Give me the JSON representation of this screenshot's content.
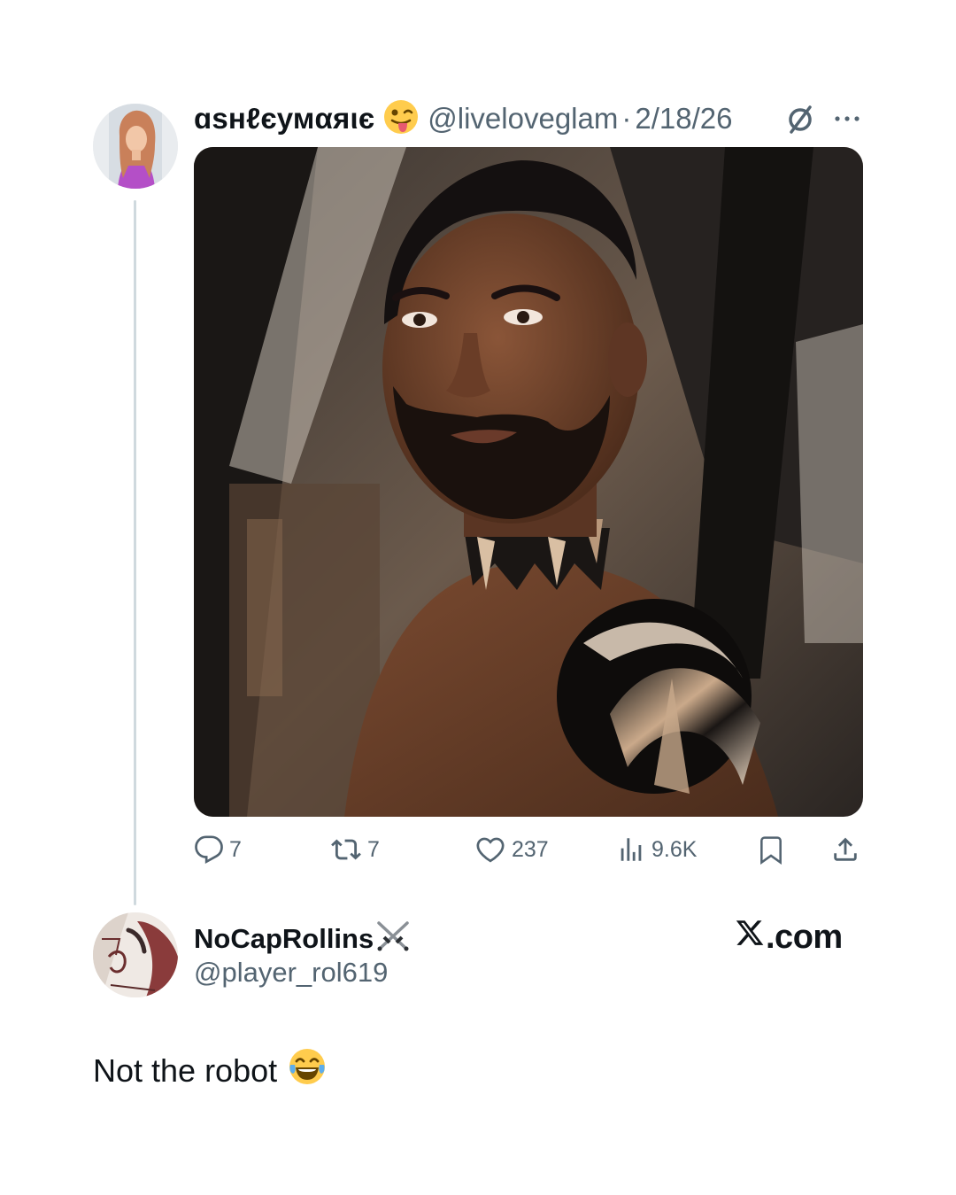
{
  "original_post": {
    "display_name": "ɑѕнℓєумαяιє",
    "name_emoji": "😜",
    "handle": "@liveloveglam",
    "separator": "·",
    "date": "2/18/26",
    "status_icon": "circle-slash-icon",
    "more_icon": "more-icon",
    "media_description_icon": "photo",
    "stats": {
      "replies": "7",
      "reposts": "7",
      "likes": "237",
      "views": "9.6K"
    }
  },
  "reply": {
    "display_name": "NoCapRollins",
    "name_emoji": "⚔️",
    "handle": "@player_rol619",
    "text": "Not the robot",
    "text_emoji": "😂"
  },
  "brand": {
    "logo_letter": "X",
    "suffix": ".com"
  },
  "colors": {
    "text_primary": "#0f1419",
    "text_secondary": "#536471",
    "thread_line": "#cfd9de",
    "background": "#ffffff"
  }
}
